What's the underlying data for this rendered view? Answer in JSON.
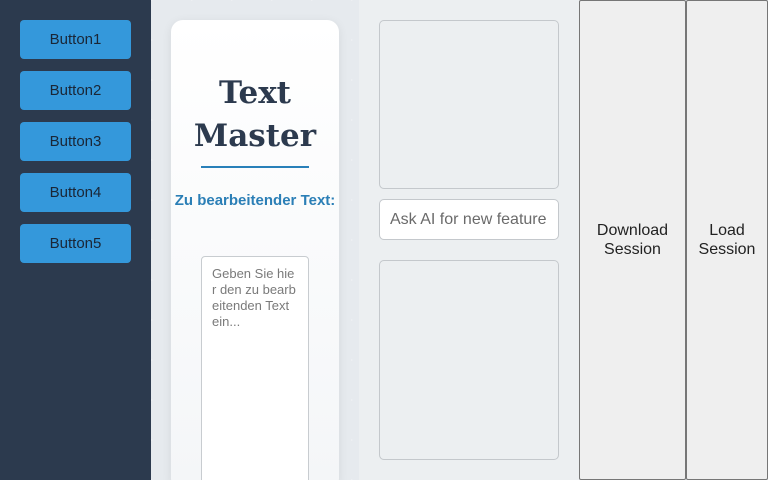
{
  "sidebar": {
    "buttons": [
      {
        "label": "Button1"
      },
      {
        "label": "Button2"
      },
      {
        "label": "Button3"
      },
      {
        "label": "Button4"
      },
      {
        "label": "Button5"
      }
    ]
  },
  "editor": {
    "title": "Text Master",
    "text_label": "Zu bearbeitender Text:",
    "text_value": "",
    "text_placeholder": "Geben Sie hier den zu bearbeitenden Text ein..."
  },
  "ai": {
    "input_value": "",
    "input_placeholder": "Ask AI for new feature"
  },
  "session": {
    "download_label": "Download Session",
    "load_label": "Load Session"
  },
  "colors": {
    "sidebar_bg": "#2c3a4e",
    "button_accent": "#3498db",
    "title_color": "#2c3a4e",
    "label_color": "#2b7fb6"
  }
}
